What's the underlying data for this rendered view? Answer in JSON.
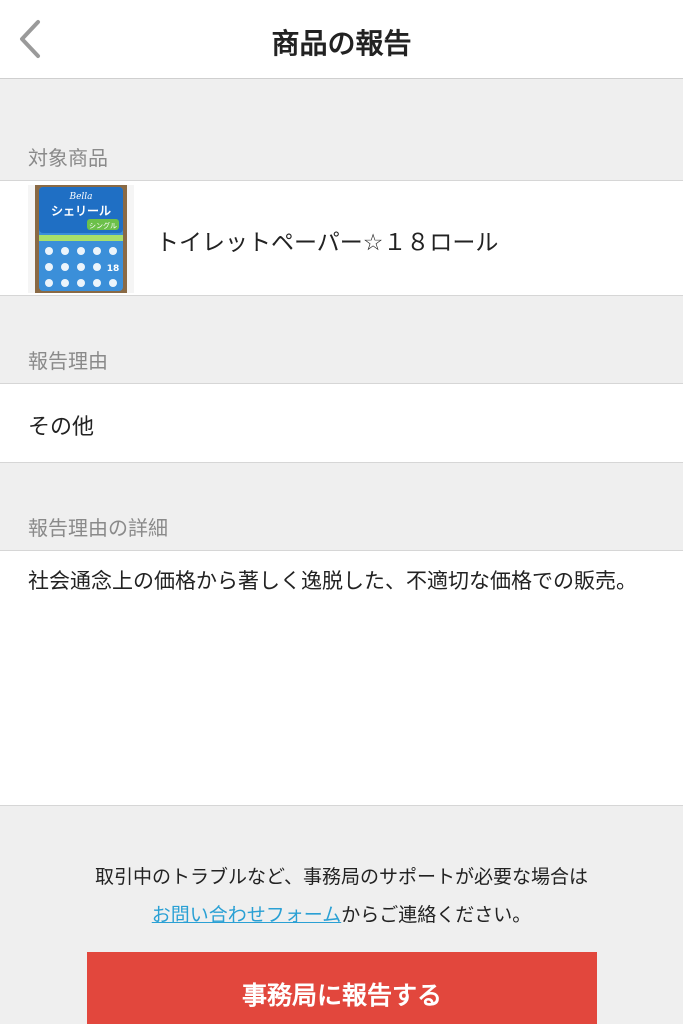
{
  "header": {
    "title": "商品の報告",
    "back_icon": "chevron-left-icon"
  },
  "target_product": {
    "label": "対象商品",
    "name": "トイレットペーパー☆１８ロール",
    "thumbnail": {
      "brand": "Bella",
      "product": "シェリール",
      "type": "シングル",
      "count": "18"
    }
  },
  "reason": {
    "label": "報告理由",
    "value": "その他"
  },
  "detail": {
    "label": "報告理由の詳細",
    "value": "社会通念上の価格から著しく逸脱した、不適切な価格での販売。"
  },
  "help": {
    "line1": "取引中のトラブルなど、事務局のサポートが必要な場合は",
    "link": "お問い合わせフォーム",
    "line2_suffix": "からご連絡ください。"
  },
  "submit_label": "事務局に報告する",
  "colors": {
    "accent": "#e2473d",
    "link": "#2aa0d4",
    "background": "#efefef"
  }
}
